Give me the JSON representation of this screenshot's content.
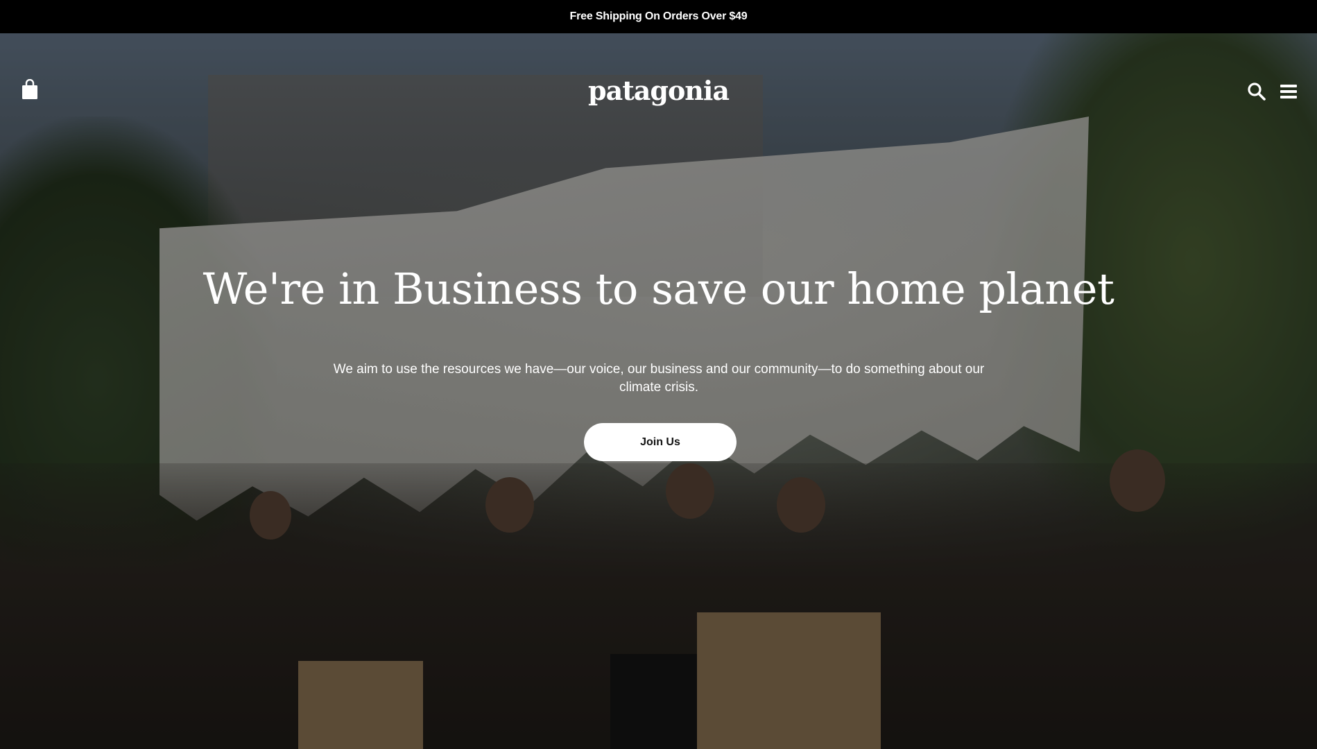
{
  "promo": {
    "text": "Free Shipping On Orders Over $49"
  },
  "header": {
    "logo_text": "patagonia",
    "icons": {
      "bag": "shopping-bag-icon",
      "search": "search-icon",
      "menu": "hamburger-menu-icon"
    }
  },
  "hero": {
    "title": "We're in Business to save our home planet",
    "subtitle": "We aim to use the resources we have—our voice, our business and our community—to do something about our climate crisis.",
    "cta_label": "Join Us"
  },
  "colors": {
    "promo_bg": "#000000",
    "text": "#ffffff",
    "button_bg": "#ffffff",
    "button_text": "#111111"
  }
}
